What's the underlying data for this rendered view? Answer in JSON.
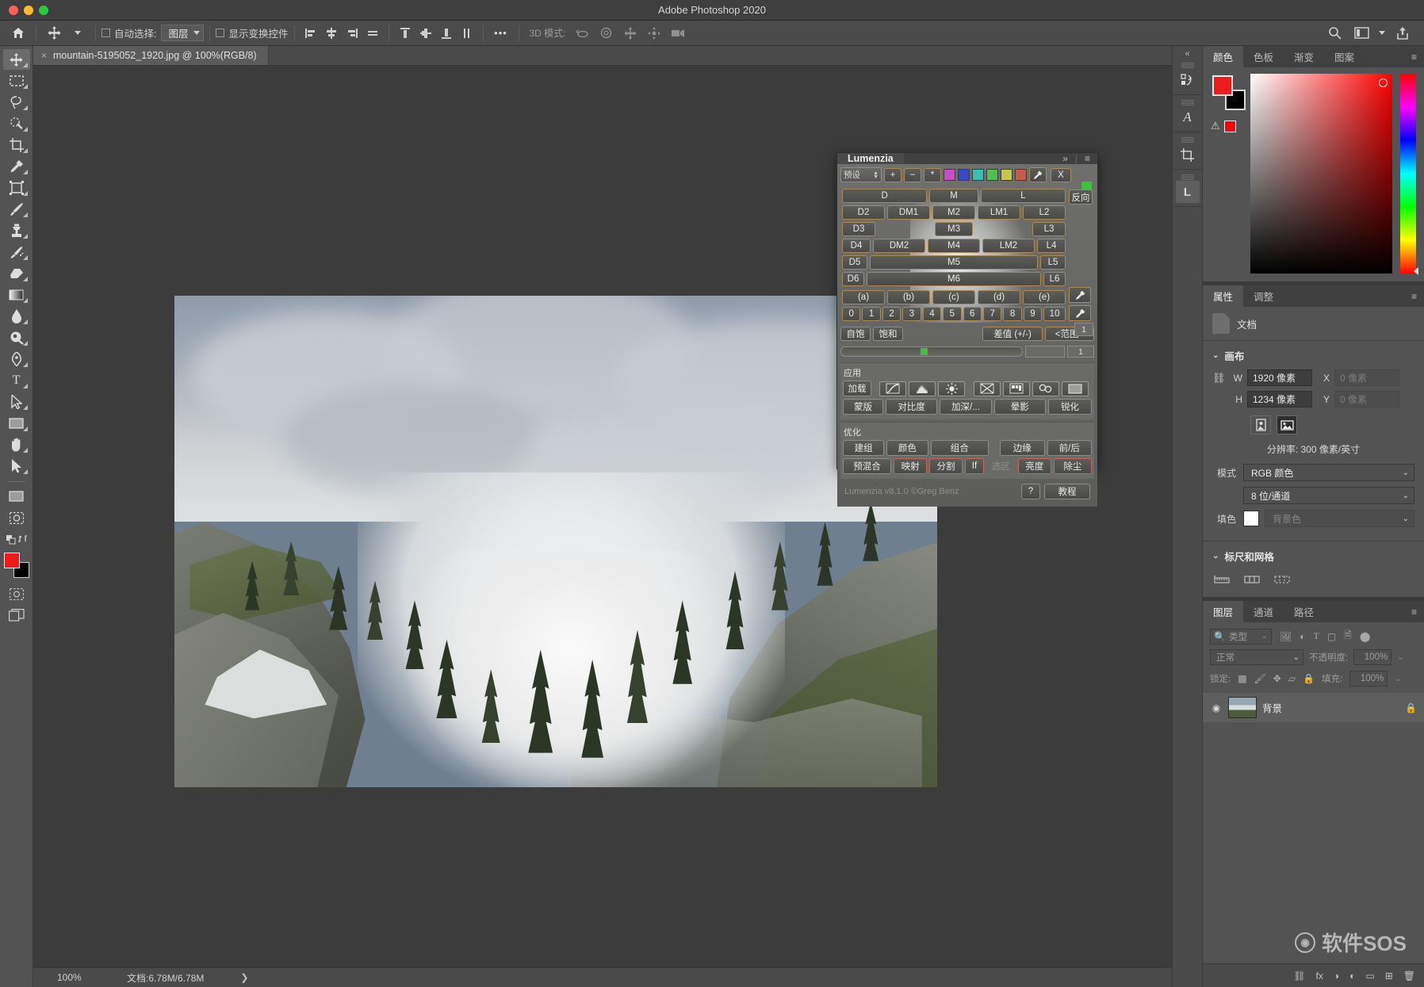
{
  "window": {
    "app_title": "Adobe Photoshop 2020"
  },
  "options_bar": {
    "home_icon": "home-icon",
    "tool_icon": "move-tool-icon",
    "auto_select_label": "自动选择:",
    "auto_select_value": "图层",
    "show_transform_label": "显示变换控件",
    "more_label": "•••",
    "mode_3d_label": "3D 模式:",
    "align_icons": [
      "align-left",
      "align-center-h",
      "align-right",
      "distribute-h",
      "align-top",
      "align-center-v",
      "align-bottom",
      "distribute-v"
    ],
    "mode3d_icons": [
      "rotate-3d-icon",
      "roll-3d-icon",
      "drag-3d-icon",
      "slide-3d-icon",
      "scale-3d-icon"
    ],
    "right_icons": [
      "search-icon",
      "workspace-icon",
      "chevron-down-icon",
      "share-icon"
    ]
  },
  "toolbar": {
    "tools": [
      {
        "name": "move-tool",
        "glyph": "✥",
        "selected": true
      },
      {
        "name": "marquee-tool",
        "glyph": "▢"
      },
      {
        "name": "lasso-tool",
        "glyph": "◯"
      },
      {
        "name": "quick-select-tool",
        "glyph": "✑"
      },
      {
        "name": "crop-tool",
        "glyph": "⌗"
      },
      {
        "name": "eyedropper-tool",
        "glyph": "✒"
      },
      {
        "name": "frame-tool",
        "glyph": "▣"
      },
      {
        "name": "brush-tool",
        "glyph": "🖌"
      },
      {
        "name": "clone-stamp-tool",
        "glyph": "⚲"
      },
      {
        "name": "history-brush-tool",
        "glyph": "✎"
      },
      {
        "name": "eraser-tool",
        "glyph": "◤"
      },
      {
        "name": "gradient-tool",
        "glyph": "▭"
      },
      {
        "name": "blur-tool",
        "glyph": "💧"
      },
      {
        "name": "dodge-tool",
        "glyph": "◔"
      },
      {
        "name": "pen-tool",
        "glyph": "✐"
      },
      {
        "name": "type-tool",
        "glyph": "T"
      },
      {
        "name": "path-select-tool",
        "glyph": "⬈"
      },
      {
        "name": "shape-tool",
        "glyph": "▬"
      },
      {
        "name": "hand-tool",
        "glyph": "✋"
      },
      {
        "name": "zoom-tool",
        "glyph": "⬉"
      },
      {
        "name": "edit-toolbar",
        "glyph": "▭"
      },
      {
        "name": "quick-mask",
        "glyph": "◙"
      }
    ],
    "foreground_color": "#ec1c1c",
    "background_color": "#000000"
  },
  "document": {
    "tab_title": "mountain-5195052_1920.jpg @ 100%(RGB/8)",
    "close_glyph": "×"
  },
  "status_bar": {
    "zoom": "100%",
    "doc_size": "文档:6.78M/6.78M",
    "arrow": "❯"
  },
  "icon_rail": {
    "collapse": "«",
    "buttons": [
      {
        "name": "libraries-icon",
        "glyph": "⎘"
      },
      {
        "name": "glyphs-icon",
        "glyph": "𝒜"
      },
      {
        "name": "crop-panel-icon",
        "glyph": "⌗"
      },
      {
        "name": "lumenzia-icon",
        "glyph": "L",
        "selected": true
      }
    ]
  },
  "color_panel": {
    "tabs": [
      {
        "label": "颜色",
        "active": true
      },
      {
        "label": "色板",
        "active": false
      },
      {
        "label": "渐变",
        "active": false
      },
      {
        "label": "图案",
        "active": false
      }
    ],
    "menu_glyph": "≡",
    "foreground": "#ec1c1c",
    "background": "#000000",
    "warning_glyph": "⚠",
    "out_of_gamut": "#ff0000"
  },
  "properties_panel": {
    "tabs": [
      {
        "label": "属性",
        "active": true
      },
      {
        "label": "调整",
        "active": false
      }
    ],
    "menu_glyph": "≡",
    "doc_label": "文档",
    "canvas_section": {
      "title": "画布",
      "chevron": "⌄",
      "link_icon": "chain-link-icon",
      "w_label": "W",
      "w_value": "1920 像素",
      "x_label": "X",
      "x_value": "0 像素",
      "h_label": "H",
      "h_value": "1234 像素",
      "y_label": "Y",
      "y_value": "0 像素",
      "orientation_portrait": "portrait-icon",
      "orientation_landscape": "landscape-icon",
      "resolution": "分辨率: 300 像素/英寸",
      "mode_label": "模式",
      "mode_value": "RGB 颜色",
      "depth_value": "8 位/通道",
      "fill_label": "填色",
      "fill_value": "背景色"
    },
    "rulers_section": {
      "title": "标尺和网格",
      "chevron": "⌄",
      "icons": [
        "ruler-icon",
        "grid-icon",
        "guides-icon"
      ]
    }
  },
  "layers_panel": {
    "tabs": [
      {
        "label": "图层",
        "active": true
      },
      {
        "label": "通道",
        "active": false
      },
      {
        "label": "路径",
        "active": false
      }
    ],
    "menu_glyph": "≡",
    "filter_icon": "search-icon",
    "filter_label": "类型",
    "filter_type_icons": [
      "image-filter-icon",
      "adjustment-filter-icon",
      "text-filter-icon",
      "shape-filter-icon",
      "smart-object-filter-icon",
      "toggle-filter-icon"
    ],
    "blend_mode": "正常",
    "opacity_label": "不透明度:",
    "opacity_value": "100%",
    "lock_label": "锁定:",
    "lock_icons": [
      "lock-transparency-icon",
      "lock-paint-icon",
      "lock-position-icon",
      "lock-artboard-icon",
      "lock-all-icon"
    ],
    "fill_label": "填充:",
    "fill_value": "100%",
    "layers": [
      {
        "name": "背景",
        "visible": true,
        "locked": true,
        "eye_glyph": "◉",
        "lock_glyph": "🔒"
      }
    ],
    "footer_icons": [
      "link-layers-icon",
      "fx-icon",
      "mask-icon",
      "adjustment-icon",
      "group-icon",
      "new-layer-icon",
      "delete-layer-icon"
    ],
    "footer_labels": [
      "⛓",
      "fx",
      "◑",
      "◐",
      "▭",
      "⊞",
      "🗑"
    ]
  },
  "lumenzia": {
    "tabs": [
      {
        "label": "Lumenzia",
        "active": true
      }
    ],
    "collapse_glyph": "»",
    "menu_glyph": "≡",
    "preset_value": "预设",
    "plus": "+",
    "minus": "−",
    "star": "*",
    "color_swatches": [
      "#c84fc8",
      "#3a48c8",
      "#39c0b4",
      "#4fc04f",
      "#c6c64a",
      "#c85a4a"
    ],
    "eyedropper_icon": "eyedropper-icon",
    "x_label": "X",
    "invert_label": "反向",
    "mask_grid": {
      "dark_col": [
        "D",
        "D2",
        "D3",
        "D4",
        "D5",
        "D6"
      ],
      "mid_col": [
        "DM1",
        "DM2"
      ],
      "m_col": [
        "M",
        "M2",
        "M3",
        "M4",
        "M5",
        "M6"
      ],
      "lm_col": [
        "LM1",
        "LM2"
      ],
      "light_col": [
        "L",
        "L2",
        "L3",
        "L4",
        "L5",
        "L6"
      ],
      "zone_row": [
        "(a)",
        "(b)",
        "(c)",
        "(d)",
        "(e)"
      ],
      "num_row": [
        "0",
        "1",
        "2",
        "3",
        "4",
        "5",
        "6",
        "7",
        "8",
        "9",
        "10"
      ]
    },
    "vibrance_label": "自饱",
    "saturation_label": "饱和",
    "difference_label": "差值 (+/-)",
    "range_label": "<范围>",
    "slider_value": "1",
    "apply_section": {
      "title": "应用",
      "load_label": "加载",
      "icon_buttons": [
        "curves-icon",
        "levels-icon",
        "brightness-icon",
        "gradient-map-icon",
        "channel-mixer-icon",
        "balance-icon",
        "solid-fill-icon"
      ],
      "mask_label": "蒙版",
      "contrast_label": "对比度",
      "dodgeburn_label": "加深/...",
      "vignette_label": "晕影",
      "sharpen_label": "锐化"
    },
    "refine_section": {
      "title": "优化",
      "group_label": "建组",
      "color_label": "颜色",
      "combine_label": "组合",
      "edge_label": "边缘",
      "beforeafter_label": "前/后",
      "blend_label": "预混合",
      "map_label": "映射",
      "split_label": "分割",
      "if_label": "If",
      "selection_label": "选区",
      "luminosity_label": "亮度",
      "dust_label": "除尘"
    },
    "footer": {
      "copyright": "Lumenzia v8.1.0 ©Greg Benz",
      "help_label": "?",
      "tutorial_label": "教程"
    }
  },
  "watermark": {
    "text": "软件SOS",
    "logo": "sos-logo-icon"
  }
}
